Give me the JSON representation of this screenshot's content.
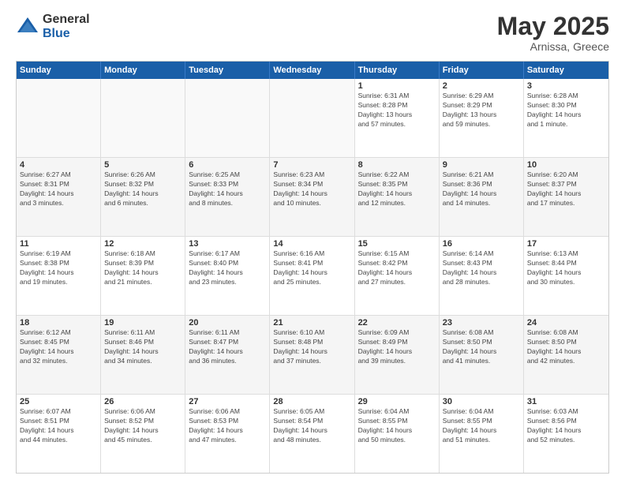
{
  "header": {
    "logo_general": "General",
    "logo_blue": "Blue",
    "title": "May 2025",
    "subtitle": "Arnissa, Greece"
  },
  "calendar": {
    "days_of_week": [
      "Sunday",
      "Monday",
      "Tuesday",
      "Wednesday",
      "Thursday",
      "Friday",
      "Saturday"
    ],
    "rows": [
      [
        {
          "day": "",
          "info": "",
          "empty": true
        },
        {
          "day": "",
          "info": "",
          "empty": true
        },
        {
          "day": "",
          "info": "",
          "empty": true
        },
        {
          "day": "",
          "info": "",
          "empty": true
        },
        {
          "day": "1",
          "info": "Sunrise: 6:31 AM\nSunset: 8:28 PM\nDaylight: 13 hours\nand 57 minutes."
        },
        {
          "day": "2",
          "info": "Sunrise: 6:29 AM\nSunset: 8:29 PM\nDaylight: 13 hours\nand 59 minutes."
        },
        {
          "day": "3",
          "info": "Sunrise: 6:28 AM\nSunset: 8:30 PM\nDaylight: 14 hours\nand 1 minute."
        }
      ],
      [
        {
          "day": "4",
          "info": "Sunrise: 6:27 AM\nSunset: 8:31 PM\nDaylight: 14 hours\nand 3 minutes."
        },
        {
          "day": "5",
          "info": "Sunrise: 6:26 AM\nSunset: 8:32 PM\nDaylight: 14 hours\nand 6 minutes."
        },
        {
          "day": "6",
          "info": "Sunrise: 6:25 AM\nSunset: 8:33 PM\nDaylight: 14 hours\nand 8 minutes."
        },
        {
          "day": "7",
          "info": "Sunrise: 6:23 AM\nSunset: 8:34 PM\nDaylight: 14 hours\nand 10 minutes."
        },
        {
          "day": "8",
          "info": "Sunrise: 6:22 AM\nSunset: 8:35 PM\nDaylight: 14 hours\nand 12 minutes."
        },
        {
          "day": "9",
          "info": "Sunrise: 6:21 AM\nSunset: 8:36 PM\nDaylight: 14 hours\nand 14 minutes."
        },
        {
          "day": "10",
          "info": "Sunrise: 6:20 AM\nSunset: 8:37 PM\nDaylight: 14 hours\nand 17 minutes."
        }
      ],
      [
        {
          "day": "11",
          "info": "Sunrise: 6:19 AM\nSunset: 8:38 PM\nDaylight: 14 hours\nand 19 minutes."
        },
        {
          "day": "12",
          "info": "Sunrise: 6:18 AM\nSunset: 8:39 PM\nDaylight: 14 hours\nand 21 minutes."
        },
        {
          "day": "13",
          "info": "Sunrise: 6:17 AM\nSunset: 8:40 PM\nDaylight: 14 hours\nand 23 minutes."
        },
        {
          "day": "14",
          "info": "Sunrise: 6:16 AM\nSunset: 8:41 PM\nDaylight: 14 hours\nand 25 minutes."
        },
        {
          "day": "15",
          "info": "Sunrise: 6:15 AM\nSunset: 8:42 PM\nDaylight: 14 hours\nand 27 minutes."
        },
        {
          "day": "16",
          "info": "Sunrise: 6:14 AM\nSunset: 8:43 PM\nDaylight: 14 hours\nand 28 minutes."
        },
        {
          "day": "17",
          "info": "Sunrise: 6:13 AM\nSunset: 8:44 PM\nDaylight: 14 hours\nand 30 minutes."
        }
      ],
      [
        {
          "day": "18",
          "info": "Sunrise: 6:12 AM\nSunset: 8:45 PM\nDaylight: 14 hours\nand 32 minutes."
        },
        {
          "day": "19",
          "info": "Sunrise: 6:11 AM\nSunset: 8:46 PM\nDaylight: 14 hours\nand 34 minutes."
        },
        {
          "day": "20",
          "info": "Sunrise: 6:11 AM\nSunset: 8:47 PM\nDaylight: 14 hours\nand 36 minutes."
        },
        {
          "day": "21",
          "info": "Sunrise: 6:10 AM\nSunset: 8:48 PM\nDaylight: 14 hours\nand 37 minutes."
        },
        {
          "day": "22",
          "info": "Sunrise: 6:09 AM\nSunset: 8:49 PM\nDaylight: 14 hours\nand 39 minutes."
        },
        {
          "day": "23",
          "info": "Sunrise: 6:08 AM\nSunset: 8:50 PM\nDaylight: 14 hours\nand 41 minutes."
        },
        {
          "day": "24",
          "info": "Sunrise: 6:08 AM\nSunset: 8:50 PM\nDaylight: 14 hours\nand 42 minutes."
        }
      ],
      [
        {
          "day": "25",
          "info": "Sunrise: 6:07 AM\nSunset: 8:51 PM\nDaylight: 14 hours\nand 44 minutes."
        },
        {
          "day": "26",
          "info": "Sunrise: 6:06 AM\nSunset: 8:52 PM\nDaylight: 14 hours\nand 45 minutes."
        },
        {
          "day": "27",
          "info": "Sunrise: 6:06 AM\nSunset: 8:53 PM\nDaylight: 14 hours\nand 47 minutes."
        },
        {
          "day": "28",
          "info": "Sunrise: 6:05 AM\nSunset: 8:54 PM\nDaylight: 14 hours\nand 48 minutes."
        },
        {
          "day": "29",
          "info": "Sunrise: 6:04 AM\nSunset: 8:55 PM\nDaylight: 14 hours\nand 50 minutes."
        },
        {
          "day": "30",
          "info": "Sunrise: 6:04 AM\nSunset: 8:55 PM\nDaylight: 14 hours\nand 51 minutes."
        },
        {
          "day": "31",
          "info": "Sunrise: 6:03 AM\nSunset: 8:56 PM\nDaylight: 14 hours\nand 52 minutes."
        }
      ]
    ]
  }
}
